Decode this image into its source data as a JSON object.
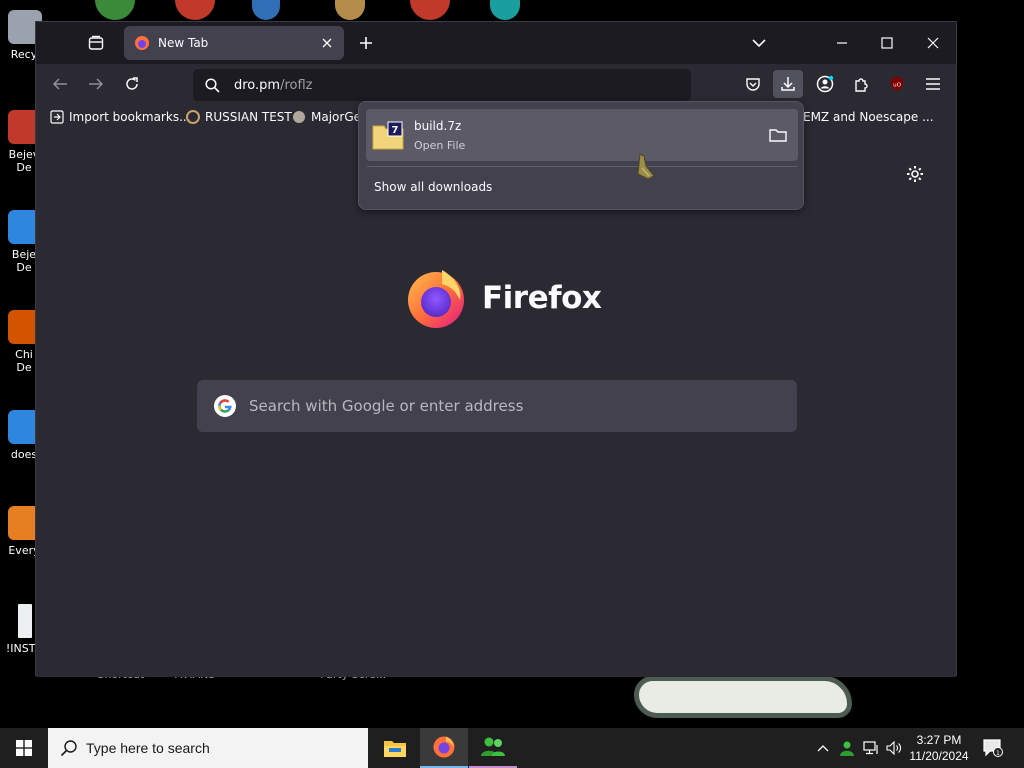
{
  "desktop": {
    "icons": [
      {
        "label": "Recy"
      },
      {
        "label": "Bejev",
        "label2": "De"
      },
      {
        "label": "Beje",
        "label2": "De"
      },
      {
        "label": "Chi",
        "label2": "De"
      },
      {
        "label": "does"
      },
      {
        "label": "Every"
      },
      {
        "label": "!INSTA"
      }
    ],
    "peek_labels": [
      "- Shortcut",
      "AVIANS",
      "Party Scre..."
    ]
  },
  "browser": {
    "tab": {
      "title": "New Tab"
    },
    "url": {
      "host": "dro.pm",
      "path": "/roflz"
    },
    "bookmarks": [
      {
        "label": "Import bookmarks..."
      },
      {
        "label": "RUSSIAN TEST"
      },
      {
        "label": "MajorGe"
      },
      {
        "label": "EMZ and Noescape ..."
      }
    ],
    "newtab": {
      "wordmark": "Firefox",
      "search_placeholder": "Search with Google or enter address"
    },
    "downloads_panel": {
      "items": [
        {
          "name": "build.7z",
          "status": "Open File"
        }
      ],
      "show_all_label": "Show all downloads"
    }
  },
  "taskbar": {
    "search_placeholder": "Type here to search",
    "clock": {
      "time": "3:27 PM",
      "date": "11/20/2024"
    },
    "notification_count": "1"
  },
  "colors": {
    "chrome_dark": "#1c1b22",
    "toolbar": "#2b2a33",
    "panel": "#42414d",
    "accent": "#00ddff"
  }
}
